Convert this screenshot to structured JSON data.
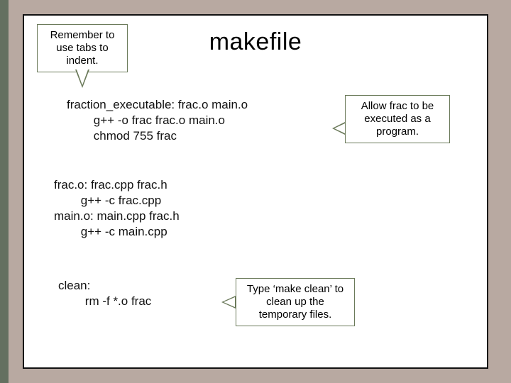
{
  "title": "makefile",
  "callouts": {
    "remember": "Remember to use tabs to indent.",
    "allow": "Allow frac to be executed as a program.",
    "clean": "Type ‘make clean’ to clean up the temporary files."
  },
  "code": {
    "block1": "fraction_executable: frac.o main.o\n        g++ -o frac frac.o main.o\n        chmod 755 frac",
    "block2": "frac.o: frac.cpp frac.h\n        g++ -c frac.cpp\nmain.o: main.cpp frac.h\n        g++ -c main.cpp",
    "block3": "clean:\n        rm -f *.o frac"
  }
}
